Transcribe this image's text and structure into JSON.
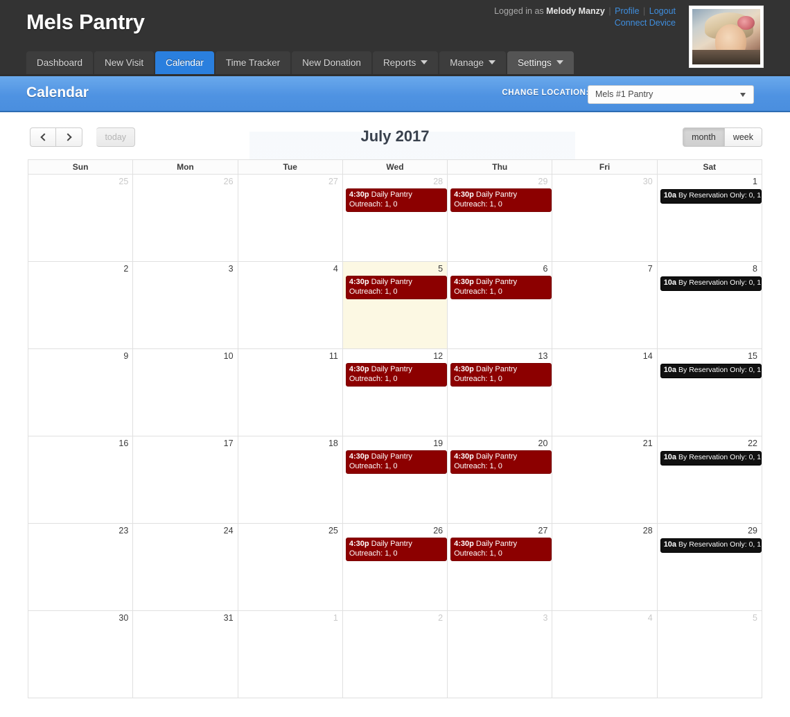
{
  "app": {
    "brand": "Mels Pantry"
  },
  "account": {
    "logged_in_prefix": "Logged in as",
    "user_name": "Melody Manzy",
    "separator": "|",
    "profile_label": "Profile",
    "logout_label": "Logout",
    "connect_device_label": "Connect Device",
    "avatar_alt": "user-avatar-photo"
  },
  "nav": {
    "tabs": [
      {
        "label": "Dashboard",
        "state": "normal",
        "caret": false
      },
      {
        "label": "New Visit",
        "state": "normal",
        "caret": false
      },
      {
        "label": "Calendar",
        "state": "active",
        "caret": false
      },
      {
        "label": "Time Tracker",
        "state": "normal",
        "caret": false
      },
      {
        "label": "New Donation",
        "state": "normal",
        "caret": false
      },
      {
        "label": "Reports",
        "state": "normal",
        "caret": true
      },
      {
        "label": "Manage",
        "state": "normal",
        "caret": true
      },
      {
        "label": "Settings",
        "state": "hover",
        "caret": true
      }
    ]
  },
  "subheader": {
    "page_title": "Calendar",
    "change_location_label": "CHANGE LOCATION:",
    "location_value": "Mels #1 Pantry",
    "location_options": [
      "Mels #1 Pantry"
    ]
  },
  "toolbar": {
    "prev_label": "prev-month",
    "next_label": "next-month",
    "today_label": "today",
    "today_disabled": true,
    "title": "July 2017",
    "view_month_label": "month",
    "view_week_label": "week",
    "active_view": "month"
  },
  "calendar": {
    "day_headers": [
      "Sun",
      "Mon",
      "Tue",
      "Wed",
      "Thu",
      "Fri",
      "Sat"
    ],
    "events": {
      "pantry": {
        "time": "4:30p",
        "title": "Daily Pantry Outreach: 1, 0",
        "color": "#8c0000",
        "kind": "red"
      },
      "reservation": {
        "time": "10a",
        "title": "By Reservation Only: 0, 1",
        "color": "#111111",
        "kind": "black"
      }
    },
    "weeks": [
      [
        {
          "num": "25",
          "other": true,
          "today": false,
          "events": []
        },
        {
          "num": "26",
          "other": true,
          "today": false,
          "events": []
        },
        {
          "num": "27",
          "other": true,
          "today": false,
          "events": []
        },
        {
          "num": "28",
          "other": true,
          "today": false,
          "events": [
            "pantry"
          ]
        },
        {
          "num": "29",
          "other": true,
          "today": false,
          "events": [
            "pantry"
          ]
        },
        {
          "num": "30",
          "other": true,
          "today": false,
          "events": []
        },
        {
          "num": "1",
          "other": false,
          "today": false,
          "events": [
            "reservation"
          ]
        }
      ],
      [
        {
          "num": "2",
          "other": false,
          "today": false,
          "events": []
        },
        {
          "num": "3",
          "other": false,
          "today": false,
          "events": []
        },
        {
          "num": "4",
          "other": false,
          "today": false,
          "events": []
        },
        {
          "num": "5",
          "other": false,
          "today": true,
          "events": [
            "pantry"
          ]
        },
        {
          "num": "6",
          "other": false,
          "today": false,
          "events": [
            "pantry"
          ]
        },
        {
          "num": "7",
          "other": false,
          "today": false,
          "events": []
        },
        {
          "num": "8",
          "other": false,
          "today": false,
          "events": [
            "reservation"
          ]
        }
      ],
      [
        {
          "num": "9",
          "other": false,
          "today": false,
          "events": []
        },
        {
          "num": "10",
          "other": false,
          "today": false,
          "events": []
        },
        {
          "num": "11",
          "other": false,
          "today": false,
          "events": []
        },
        {
          "num": "12",
          "other": false,
          "today": false,
          "events": [
            "pantry"
          ]
        },
        {
          "num": "13",
          "other": false,
          "today": false,
          "events": [
            "pantry"
          ]
        },
        {
          "num": "14",
          "other": false,
          "today": false,
          "events": []
        },
        {
          "num": "15",
          "other": false,
          "today": false,
          "events": [
            "reservation"
          ]
        }
      ],
      [
        {
          "num": "16",
          "other": false,
          "today": false,
          "events": []
        },
        {
          "num": "17",
          "other": false,
          "today": false,
          "events": []
        },
        {
          "num": "18",
          "other": false,
          "today": false,
          "events": []
        },
        {
          "num": "19",
          "other": false,
          "today": false,
          "events": [
            "pantry"
          ]
        },
        {
          "num": "20",
          "other": false,
          "today": false,
          "events": [
            "pantry"
          ]
        },
        {
          "num": "21",
          "other": false,
          "today": false,
          "events": []
        },
        {
          "num": "22",
          "other": false,
          "today": false,
          "events": [
            "reservation"
          ]
        }
      ],
      [
        {
          "num": "23",
          "other": false,
          "today": false,
          "events": []
        },
        {
          "num": "24",
          "other": false,
          "today": false,
          "events": []
        },
        {
          "num": "25",
          "other": false,
          "today": false,
          "events": []
        },
        {
          "num": "26",
          "other": false,
          "today": false,
          "events": [
            "pantry"
          ]
        },
        {
          "num": "27",
          "other": false,
          "today": false,
          "events": [
            "pantry"
          ]
        },
        {
          "num": "28",
          "other": false,
          "today": false,
          "events": []
        },
        {
          "num": "29",
          "other": false,
          "today": false,
          "events": [
            "reservation"
          ]
        }
      ],
      [
        {
          "num": "30",
          "other": false,
          "today": false,
          "events": []
        },
        {
          "num": "31",
          "other": false,
          "today": false,
          "events": []
        },
        {
          "num": "1",
          "other": true,
          "today": false,
          "events": []
        },
        {
          "num": "2",
          "other": true,
          "today": false,
          "events": []
        },
        {
          "num": "3",
          "other": true,
          "today": false,
          "events": []
        },
        {
          "num": "4",
          "other": true,
          "today": false,
          "events": []
        },
        {
          "num": "5",
          "other": true,
          "today": false,
          "events": []
        }
      ]
    ]
  },
  "theme": {
    "header_bg": "#333333",
    "accent_blue": "#2a7fde",
    "subbar_blue": "#4f93e2",
    "event_red": "#8c0000",
    "event_black": "#111111",
    "today_bg": "#fcf8e3"
  }
}
